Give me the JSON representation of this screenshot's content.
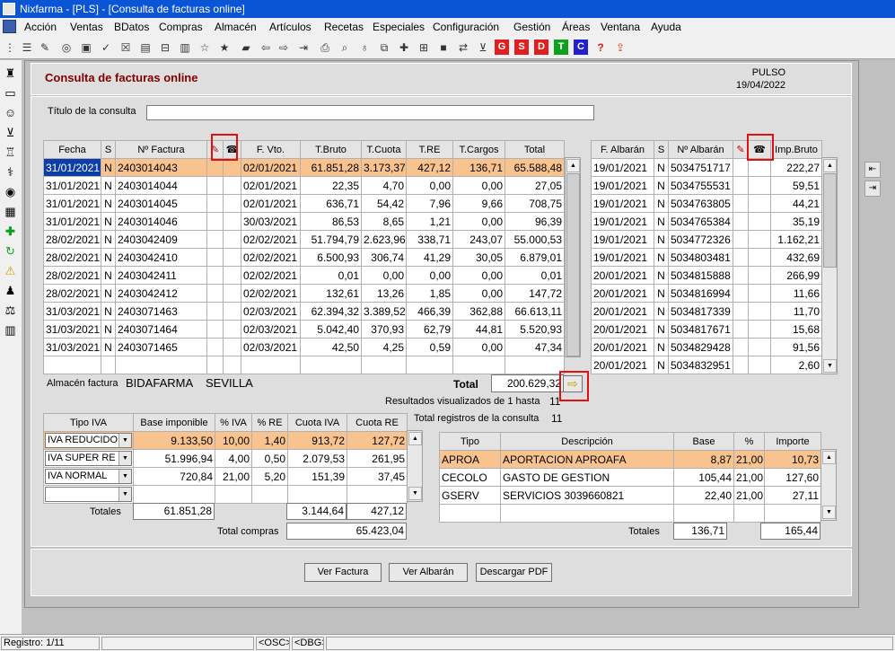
{
  "window": {
    "title": "Nixfarma - [PLS] - [Consulta de facturas online]"
  },
  "menu": [
    "Acción",
    "Ventas",
    "BDatos",
    "Compras",
    "Almacén",
    "Artículos",
    "Recetas",
    "Especiales",
    "Configuración",
    "Gestión",
    "Áreas",
    "Ventana",
    "Ayuda"
  ],
  "toolbar_letters": [
    {
      "t": "G",
      "c": "#e02020"
    },
    {
      "t": "S",
      "c": "#e02020"
    },
    {
      "t": "D",
      "c": "#e02020"
    },
    {
      "t": "T",
      "c": "#10a020"
    },
    {
      "t": "C",
      "c": "#2020d0"
    }
  ],
  "header": {
    "title": "Consulta de facturas online",
    "right1": "PULSO",
    "right2": "19/04/2022"
  },
  "titulo_label": "Título de la consulta",
  "titulo_value": "",
  "facturas": {
    "columns": [
      "Fecha",
      "S",
      "Nº Factura",
      "",
      "",
      "F. Vto.",
      "T.Bruto",
      "T.Cuota",
      "T.RE",
      "T.Cargos",
      "Total"
    ],
    "rows": [
      [
        "31/01/2021",
        "N",
        "2403014043",
        "02/01/2021",
        "61.851,28",
        "3.173,37",
        "427,12",
        "136,71",
        "65.588,48"
      ],
      [
        "31/01/2021",
        "N",
        "2403014044",
        "02/01/2021",
        "22,35",
        "4,70",
        "0,00",
        "0,00",
        "27,05"
      ],
      [
        "31/01/2021",
        "N",
        "2403014045",
        "02/01/2021",
        "636,71",
        "54,42",
        "7,96",
        "9,66",
        "708,75"
      ],
      [
        "31/01/2021",
        "N",
        "2403014046",
        "30/03/2021",
        "86,53",
        "8,65",
        "1,21",
        "0,00",
        "96,39"
      ],
      [
        "28/02/2021",
        "N",
        "2403042409",
        "02/02/2021",
        "51.794,79",
        "2.623,96",
        "338,71",
        "243,07",
        "55.000,53"
      ],
      [
        "28/02/2021",
        "N",
        "2403042410",
        "02/02/2021",
        "6.500,93",
        "306,74",
        "41,29",
        "30,05",
        "6.879,01"
      ],
      [
        "28/02/2021",
        "N",
        "2403042411",
        "02/02/2021",
        "0,01",
        "0,00",
        "0,00",
        "0,00",
        "0,01"
      ],
      [
        "28/02/2021",
        "N",
        "2403042412",
        "02/02/2021",
        "132,61",
        "13,26",
        "1,85",
        "0,00",
        "147,72"
      ],
      [
        "31/03/2021",
        "N",
        "2403071463",
        "02/03/2021",
        "62.394,32",
        "3.389,52",
        "466,39",
        "362,88",
        "66.613,11"
      ],
      [
        "31/03/2021",
        "N",
        "2403071464",
        "02/03/2021",
        "5.042,40",
        "370,93",
        "62,79",
        "44,81",
        "5.520,93"
      ],
      [
        "31/03/2021",
        "N",
        "2403071465",
        "02/03/2021",
        "42,50",
        "4,25",
        "0,59",
        "0,00",
        "47,34"
      ]
    ]
  },
  "albaranes": {
    "columns": [
      "F. Albarán",
      "S",
      "Nº Albarán",
      "",
      "",
      "Imp.Bruto"
    ],
    "rows": [
      [
        "19/01/2021",
        "N",
        "5034751717",
        "222,27"
      ],
      [
        "19/01/2021",
        "N",
        "5034755531",
        "59,51"
      ],
      [
        "19/01/2021",
        "N",
        "5034763805",
        "44,21"
      ],
      [
        "19/01/2021",
        "N",
        "5034765384",
        "35,19"
      ],
      [
        "19/01/2021",
        "N",
        "5034772326",
        "1.162,21"
      ],
      [
        "19/01/2021",
        "N",
        "5034803481",
        "432,69"
      ],
      [
        "20/01/2021",
        "N",
        "5034815888",
        "266,99"
      ],
      [
        "20/01/2021",
        "N",
        "5034816994",
        "11,66"
      ],
      [
        "20/01/2021",
        "N",
        "5034817339",
        "11,70"
      ],
      [
        "20/01/2021",
        "N",
        "5034817671",
        "15,68"
      ],
      [
        "20/01/2021",
        "N",
        "5034829428",
        "91,56"
      ],
      [
        "20/01/2021",
        "N",
        "5034832951",
        "2,60"
      ]
    ]
  },
  "almacen": {
    "label": "Almacén factura",
    "name": "BIDAFARMA",
    "city": "SEVILLA"
  },
  "total": {
    "label": "Total",
    "value": "200.629,32"
  },
  "resultados": {
    "label": "Resultados visualizados de 1 hasta",
    "value": "11"
  },
  "total_registros": {
    "label": "Total registros de la consulta",
    "value": "11"
  },
  "iva": {
    "columns": [
      "Tipo IVA",
      "Base imponible",
      "% IVA",
      "% RE",
      "Cuota IVA",
      "Cuota RE"
    ],
    "rows": [
      [
        "IVA REDUCIDO",
        "9.133,50",
        "10,00",
        "1,40",
        "913,72",
        "127,72"
      ],
      [
        "IVA SUPER RE",
        "51.996,94",
        "4,00",
        "0,50",
        "2.079,53",
        "261,95"
      ],
      [
        "IVA NORMAL",
        "720,84",
        "21,00",
        "5,20",
        "151,39",
        "37,45"
      ]
    ],
    "totales_label": "Totales",
    "totales": [
      "61.851,28",
      "3.144,64",
      "427,12"
    ],
    "total_compras_label": "Total compras",
    "total_compras": "65.423,04"
  },
  "cargos": {
    "columns": [
      "Tipo",
      "Descripción",
      "Base",
      "%",
      "Importe"
    ],
    "rows": [
      [
        "APROA",
        "APORTACION APROAFA",
        "8,87",
        "21,00",
        "10,73"
      ],
      [
        "CECOLO",
        "GASTO DE GESTION",
        "105,44",
        "21,00",
        "127,60"
      ],
      [
        "GSERV",
        "SERVICIOS 3039660821",
        "22,40",
        "21,00",
        "27,11"
      ]
    ],
    "totales_label": "Totales",
    "totales": [
      "136,71",
      "165,44"
    ]
  },
  "buttons": {
    "ver_factura": "Ver Factura",
    "ver_albaran": "Ver Albarán",
    "descargar": "Descargar PDF"
  },
  "status": {
    "registro": "Registro: 1/11",
    "osc": "<OSC>",
    "dbg": "<DBG>"
  },
  "colors": {
    "selected_row": "#f8c38e",
    "header_title": "#800000",
    "titlebar": "#0a54d6"
  }
}
